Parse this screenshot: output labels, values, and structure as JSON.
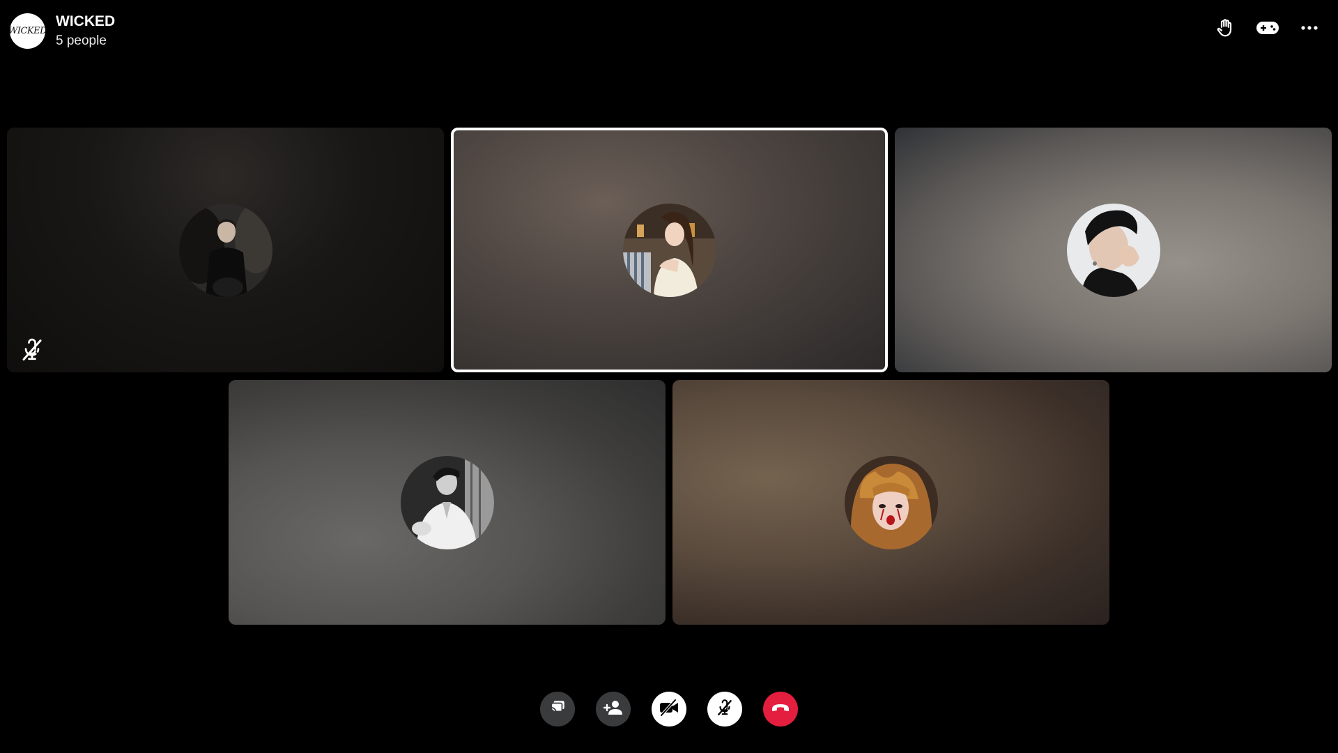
{
  "header": {
    "avatar_text": "WICKED",
    "title": "WICKED",
    "subtitle": "5 people",
    "icons": [
      "raise-hand-icon",
      "game-controller-icon",
      "more-options-icon"
    ]
  },
  "participants": [
    {
      "name": "participant-1",
      "muted": true,
      "active": false,
      "background": "#1a1816"
    },
    {
      "name": "participant-2",
      "muted": false,
      "active": true,
      "background": "#4a4440"
    },
    {
      "name": "participant-3",
      "muted": false,
      "active": false,
      "background": "#6e6a66"
    },
    {
      "name": "participant-4",
      "muted": false,
      "active": false,
      "background": "#4e4d4c"
    },
    {
      "name": "participant-5",
      "muted": false,
      "active": false,
      "background": "#4a3c32"
    }
  ],
  "controls": {
    "items": [
      "share-screen-icon",
      "add-person-icon",
      "camera-off-icon",
      "mic-off-icon",
      "end-call-icon"
    ],
    "end_call_color": "#e41e3f"
  }
}
